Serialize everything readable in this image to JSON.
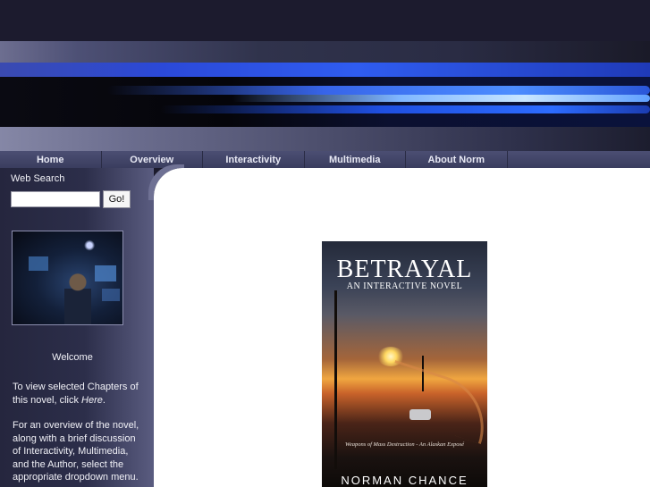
{
  "nav": {
    "items": [
      {
        "label": "Home"
      },
      {
        "label": "Overview"
      },
      {
        "label": "Interactivity"
      },
      {
        "label": "Multimedia"
      },
      {
        "label": "About Norm"
      }
    ]
  },
  "sidebar": {
    "search_label": "Web Search",
    "search_value": "",
    "go_label": "Go!",
    "welcome": "Welcome",
    "para1_prefix": "To view selected Chapters of this novel, click ",
    "para1_link": "Here",
    "para1_suffix": ".",
    "para2": "For an overview of the novel, along with a brief discussion of Interactivity, Multimedia, and the Author, select the appropriate dropdown menu."
  },
  "book": {
    "title": "BETRAYAL",
    "subtitle": "AN INTERACTIVE NOVEL",
    "tagline": "Weapons of Mass Destruction - An Alaskan Exposé",
    "author": "NORMAN CHANCE"
  }
}
